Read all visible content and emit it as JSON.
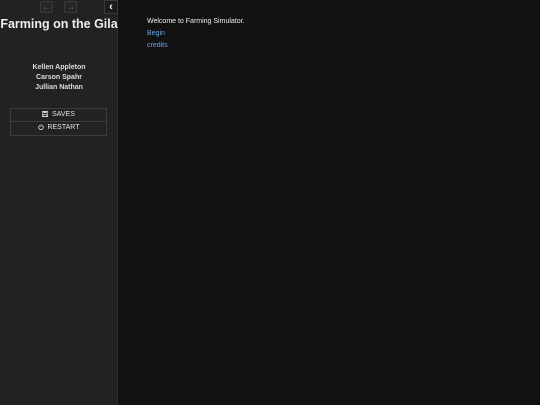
{
  "sidebar": {
    "back_icon": "←",
    "forward_icon": "→",
    "collapse_icon": "‹",
    "title": "Farming on the Gila",
    "authors": [
      "Kellen Appleton",
      "Carson Spahr",
      "Jullian Nathan"
    ],
    "saves_label": "SAVES",
    "restart_label": "RESTART"
  },
  "passage": {
    "welcome_text": "Welcome to Farming Simulator.",
    "begin_link": "Begin",
    "credits_link": "credits"
  }
}
